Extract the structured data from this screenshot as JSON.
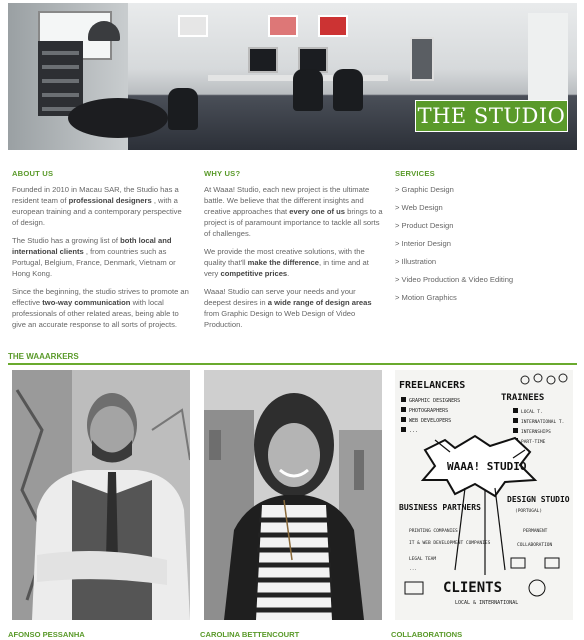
{
  "hero": {
    "label": "THE STUDIO"
  },
  "about": {
    "heading": "ABOUT US",
    "p1_a": "Founded in 2010 in Macau SAR, the Studio has a resident team of ",
    "p1_b": "professional designers",
    "p1_c": " , with a european training and a contemporary perspective of design.",
    "p2_a": "The Studio has a growing list of ",
    "p2_b": "both local and international clients",
    "p2_c": " , from countries such as Portugal, Belgium, France, Denmark, Vietnam or Hong Kong.",
    "p3_a": "Since the beginning, the studio strives to promote an effective ",
    "p3_b": "two-way communication",
    "p3_c": " with local professionals of other related areas, being able to give an accurate response to all sorts of projects."
  },
  "why": {
    "heading": "WHY US?",
    "p1_a": "At Waaa! Studio, each new project is the ultimate battle. We believe that the different insights and creative approaches that ",
    "p1_b": "every one of us",
    "p1_c": " brings to a project is of paramount importance to tackle all sorts of challenges.",
    "p2_a": "We provide the most creative solutions, with the quality that'll ",
    "p2_b": "make the difference",
    "p2_c": ", in time and at very ",
    "p2_d": "competitive prices",
    "p2_e": ".",
    "p3_a": "Waaa! Studio can serve your needs and your deepest desires in ",
    "p3_b": "a wide range of design areas",
    "p3_c": " from Graphic Design to Web Design of Video Production."
  },
  "services": {
    "heading": "SERVICES",
    "items": [
      "> Graphic Design",
      "> Web Design",
      "> Product Design",
      "> Interior Design",
      "> Illustration",
      "> Video Production & Video Editing",
      "> Motion Graphics"
    ]
  },
  "team": {
    "heading": "THE WAAARKERS",
    "members": [
      {
        "name": "AFONSO PESSANHA"
      },
      {
        "name": "CAROLINA BETTENCOURT"
      },
      {
        "name": "COLLABORATIONS"
      }
    ]
  },
  "sketch": {
    "freelancers": "FREELANCERS",
    "freelancer_items": [
      "GRAPHIC DESIGNERS",
      "PHOTOGRAPHERS",
      "WEB DEVELOPERS",
      "..."
    ],
    "trainees": "TRAINEES",
    "trainee_items": [
      "LOCAL T.",
      "INTERNATIONAL T.",
      "INTERNSHIPS",
      "PART-TIME"
    ],
    "center": "WAAA! STUDIO",
    "business": "BUSINESS PARTNERS",
    "business_items": [
      "PRINTING COMPANIES",
      "IT & WEB DEVELOPMENT COMPANIES",
      "LEGAL TEAM",
      "..."
    ],
    "design_studio": "DESIGN STUDIO",
    "design_studio_sub": "(PORTUGAL)",
    "design_items": [
      "PERMANENT",
      "COLLABORATION"
    ],
    "clients": "CLIENTS",
    "clients_sub": "LOCAL & INTERNATIONAL"
  },
  "colors": {
    "accent": "#5a9a2a"
  }
}
